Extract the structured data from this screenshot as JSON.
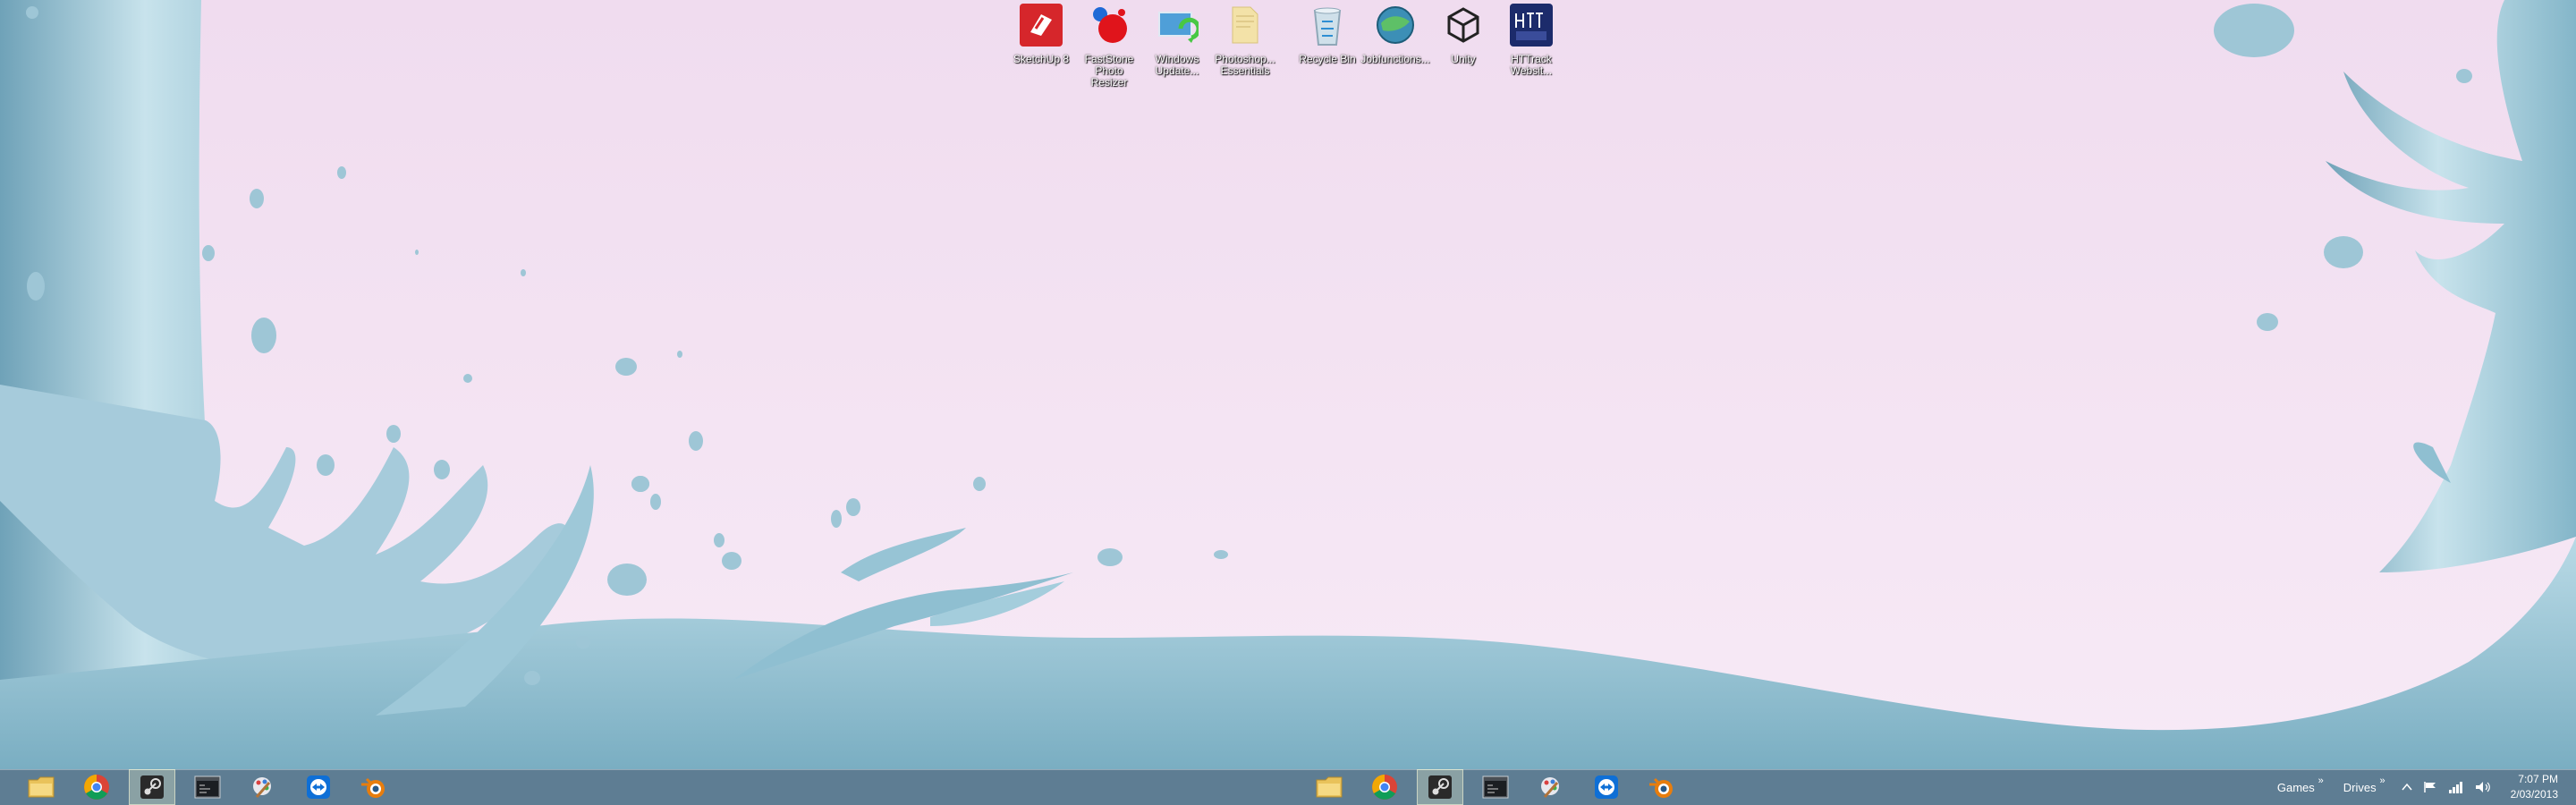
{
  "desktop": {
    "icons": [
      {
        "label": "SketchUp 8",
        "icon": "sketchup-icon"
      },
      {
        "label": "FastStone\nPhoto Resizer",
        "icon": "faststone-icon"
      },
      {
        "label": "Windows\nUpdate...",
        "icon": "windows-update-icon"
      },
      {
        "label": "Photoshop...\nEssentials",
        "icon": "folder-icon"
      },
      {
        "label": "Recycle Bin",
        "icon": "recycle-bin-icon"
      },
      {
        "label": "Jobfunctions...",
        "icon": "globe-icon"
      },
      {
        "label": "Unity",
        "icon": "unity-icon"
      },
      {
        "label": "HTTrack\nWebsit...",
        "icon": "httrack-icon"
      }
    ]
  },
  "taskbar": {
    "left_apps": [
      "file-explorer-icon",
      "chrome-icon",
      "steam-icon",
      "terminal-icon",
      "paint-icon",
      "teamviewer-icon",
      "blender-icon"
    ],
    "right_apps": [
      "file-explorer-icon",
      "chrome-icon",
      "steam-icon",
      "terminal-icon",
      "paint-icon",
      "teamviewer-icon",
      "blender-icon"
    ],
    "toolbars": [
      {
        "label": "Games",
        "chevron": "»"
      },
      {
        "label": "Drives",
        "chevron": "»"
      }
    ],
    "tray_icons": [
      "show-hidden-icon",
      "flag-icon",
      "network-icon",
      "volume-icon"
    ],
    "clock": {
      "time": "7:07 PM",
      "date": "2/03/2013"
    }
  },
  "colors": {
    "taskbar": "#5e7d93",
    "wallpaper_bg": "#f3e2f1",
    "splash": "#a9cedd"
  }
}
